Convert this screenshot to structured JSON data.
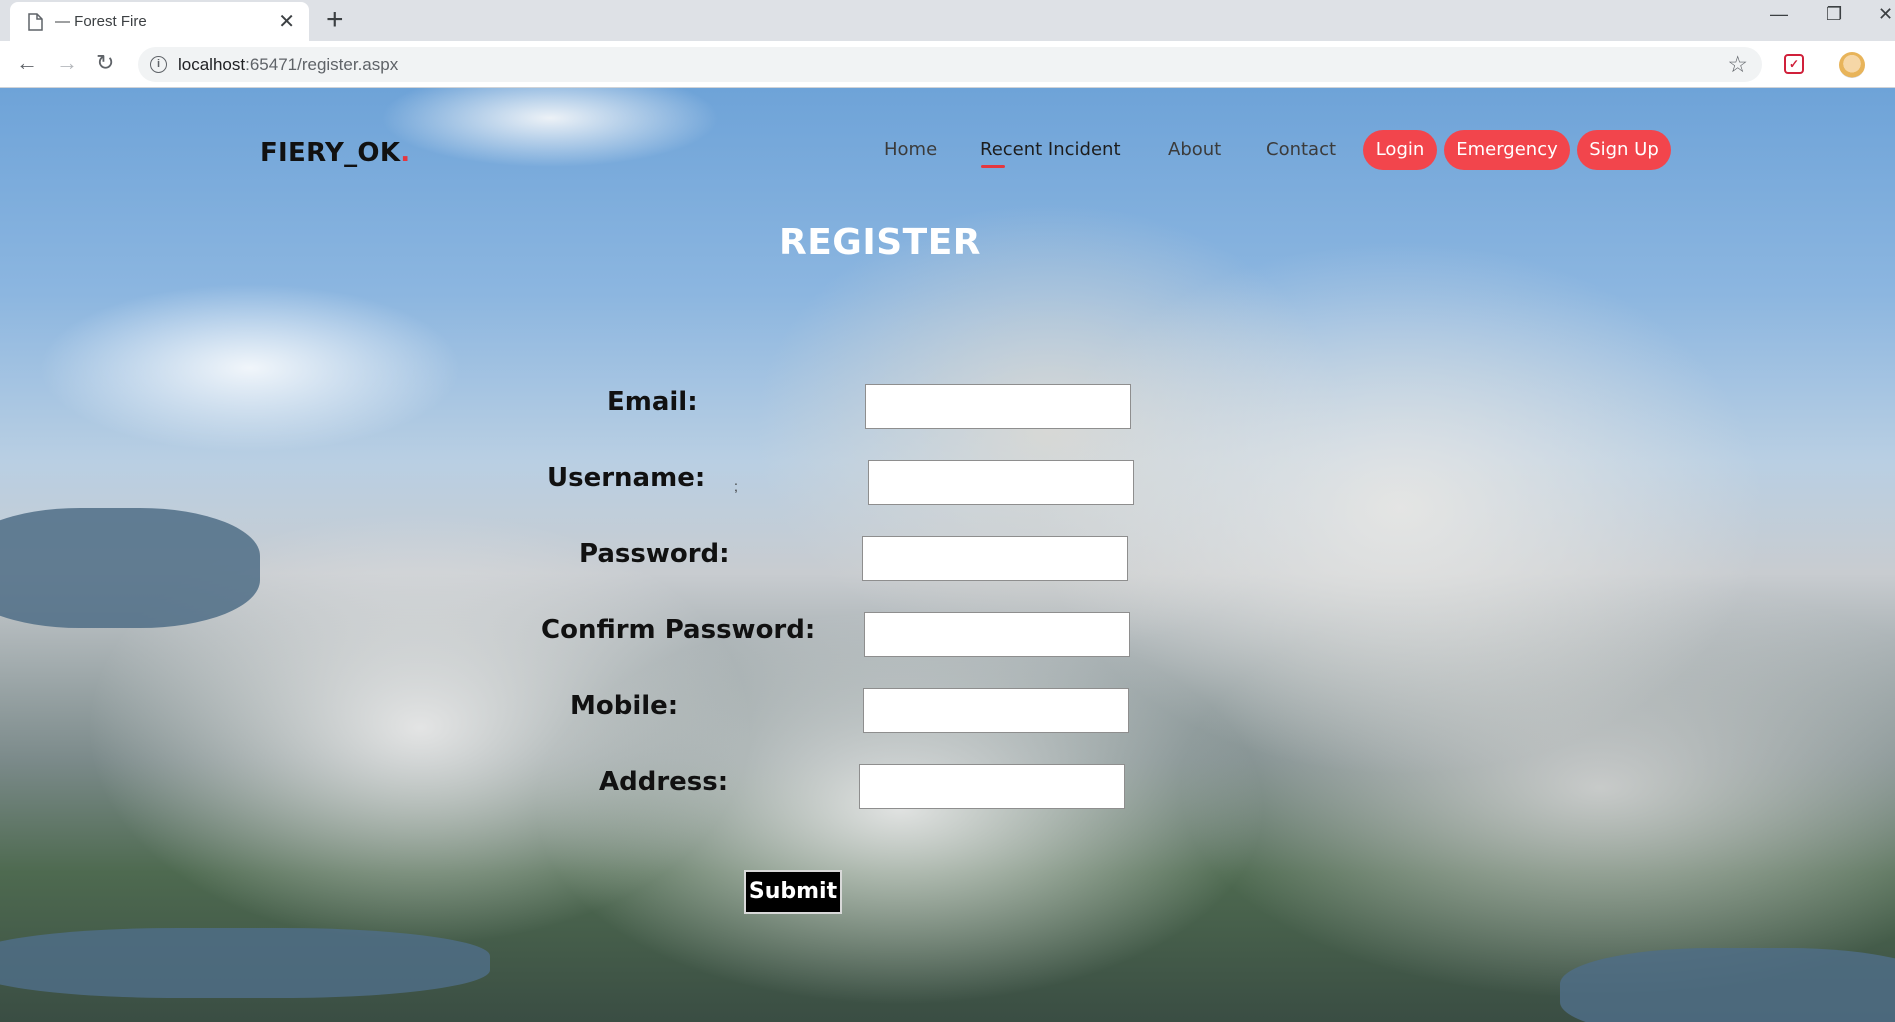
{
  "browser": {
    "tab_title": "— Forest Fire",
    "new_tab": "+",
    "url_host": "localhost",
    "url_rest": ":65471/register.aspx",
    "window_controls": [
      "—",
      "❐",
      "✕"
    ]
  },
  "site": {
    "brand": "FIERY_OK",
    "brand_dot": ".",
    "nav": {
      "home": "Home",
      "recent_incident": "Recent Incident",
      "about": "About",
      "contact": "Contact",
      "login": "Login",
      "emergency": "Emergency",
      "sign_up": "Sign Up"
    },
    "accent_color": "#f2454c"
  },
  "form": {
    "title": "REGISTER",
    "fields": {
      "email": {
        "label": "Email:",
        "value": ""
      },
      "username": {
        "label": "Username:",
        "value": ""
      },
      "password": {
        "label": "Password:",
        "value": ""
      },
      "confirm_password": {
        "label": "Confirm Password:",
        "value": ""
      },
      "mobile": {
        "label": "Mobile:",
        "value": ""
      },
      "address": {
        "label": "Address:",
        "value": ""
      }
    },
    "stray_char": ";",
    "submit_label": "Submit"
  }
}
